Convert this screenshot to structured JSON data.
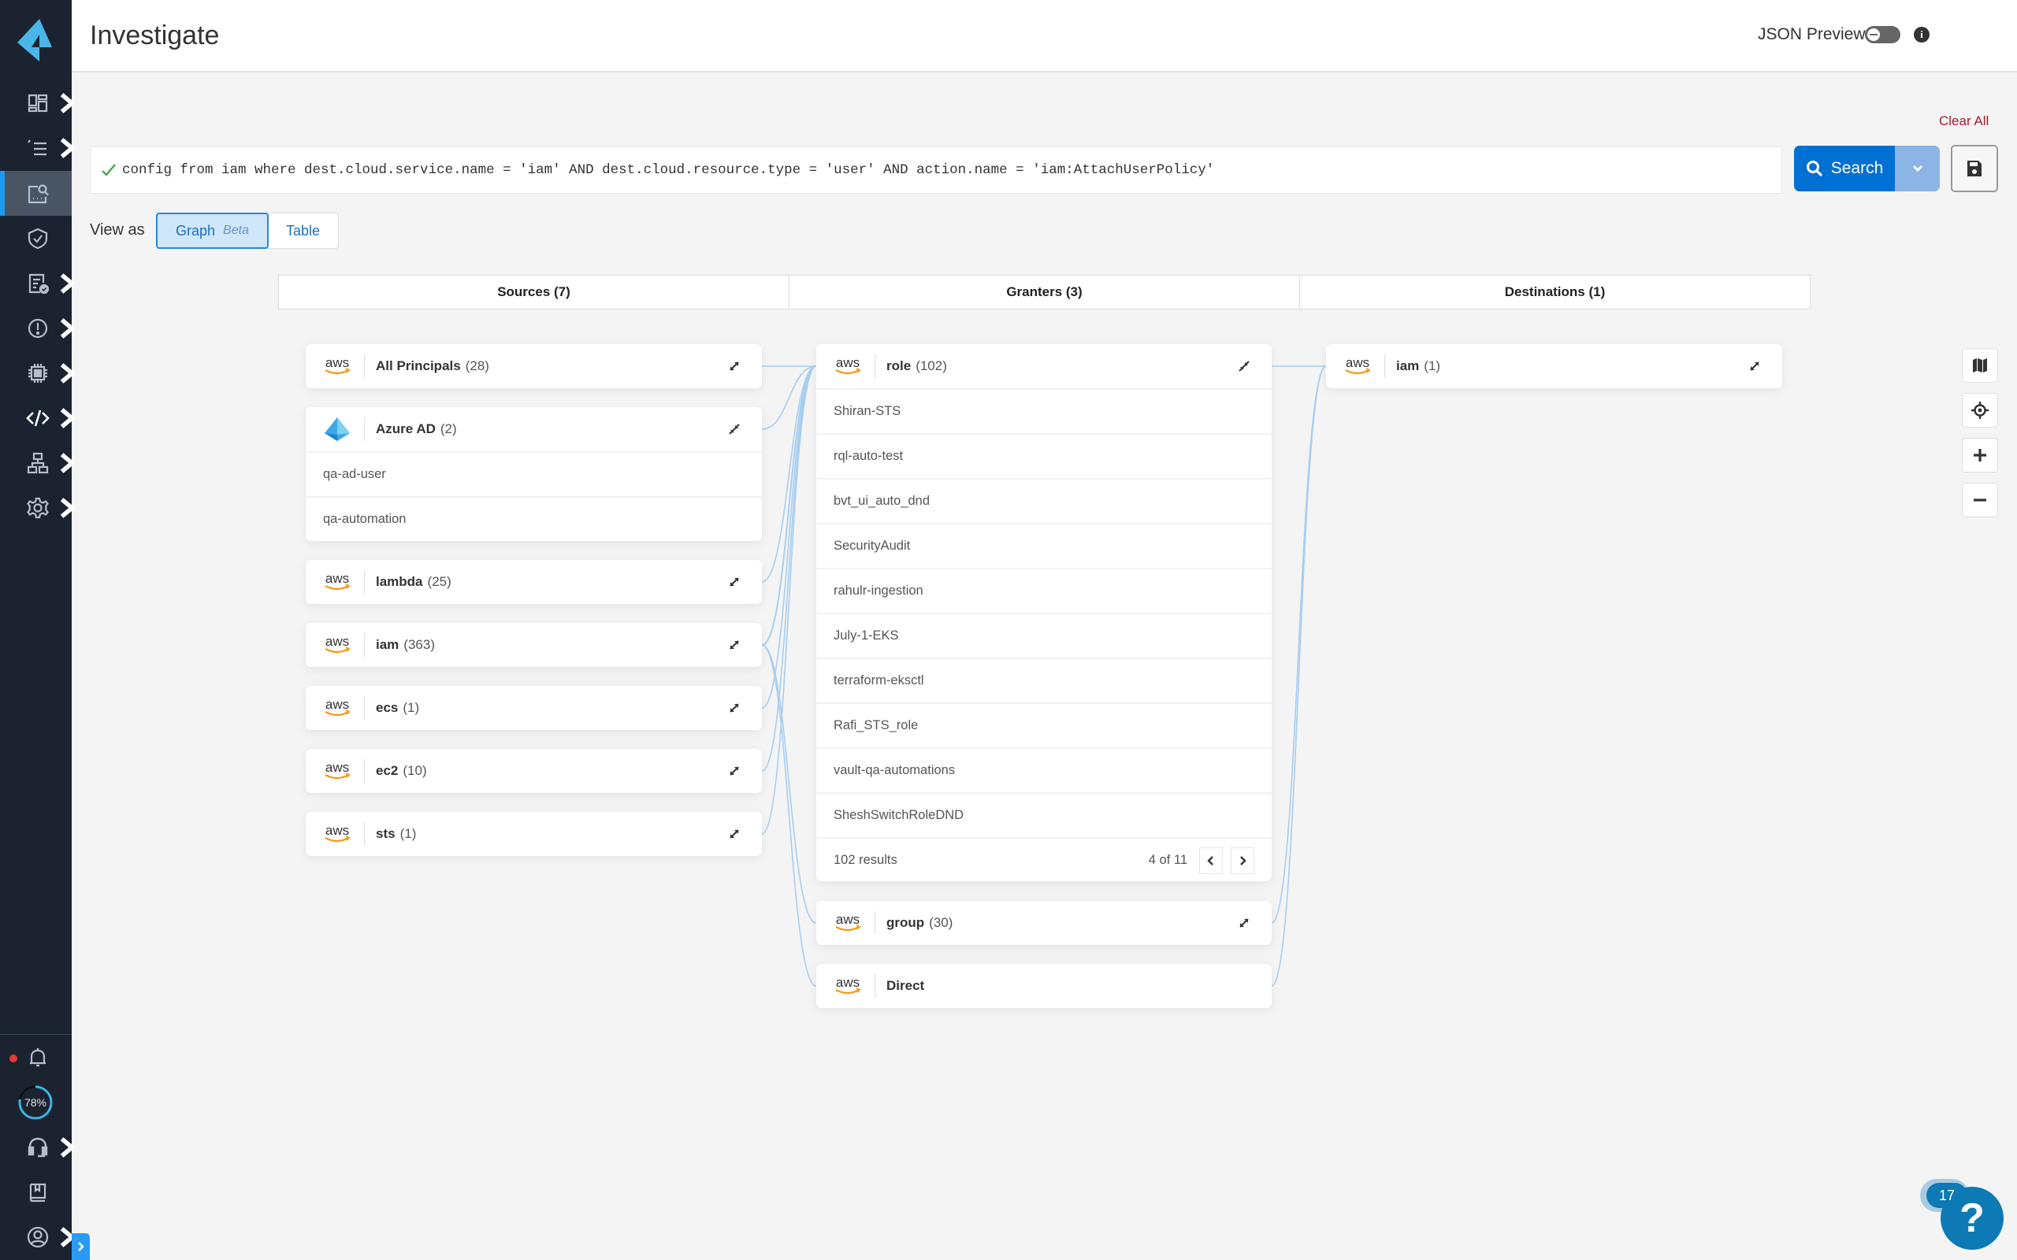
{
  "header": {
    "title": "Investigate",
    "json_preview_label": "JSON Preview",
    "json_preview_enabled": false
  },
  "sidebar": {
    "items": [
      {
        "icon": "dashboard-icon",
        "has_submenu": true
      },
      {
        "icon": "list-icon",
        "has_submenu": true
      },
      {
        "icon": "investigate-icon",
        "has_submenu": false,
        "active": true
      },
      {
        "icon": "shield-check-icon",
        "has_submenu": false
      },
      {
        "icon": "compliance-icon",
        "has_submenu": true
      },
      {
        "icon": "alert-icon",
        "has_submenu": true
      },
      {
        "icon": "chip-icon",
        "has_submenu": true
      },
      {
        "icon": "code-icon",
        "has_submenu": true
      },
      {
        "icon": "network-icon",
        "has_submenu": true
      },
      {
        "icon": "gear-icon",
        "has_submenu": true
      }
    ],
    "bottom": {
      "notifications_has_unread": true,
      "progress_text": "78%",
      "progress_value": 0.78
    }
  },
  "query": {
    "clear_all_label": "Clear All",
    "value": "config from iam where dest.cloud.service.name = 'iam' AND dest.cloud.resource.type = 'user' AND action.name = 'iam:AttachUserPolicy'",
    "valid": true,
    "search_label": "Search"
  },
  "view_as": {
    "label": "View as",
    "options": [
      {
        "label": "Graph",
        "badge": "Beta",
        "active": true
      },
      {
        "label": "Table",
        "active": false
      }
    ]
  },
  "columns": [
    {
      "label": "Sources (7)"
    },
    {
      "label": "Granters (3)"
    },
    {
      "label": "Destinations (1)"
    }
  ],
  "sources": [
    {
      "provider": "aws",
      "name": "All Principals",
      "count": "(28)",
      "expanded": false
    },
    {
      "provider": "azure",
      "name": "Azure AD",
      "count": "(2)",
      "expanded": true,
      "items": [
        "qa-ad-user",
        "qa-automation"
      ]
    },
    {
      "provider": "aws",
      "name": "lambda",
      "count": "(25)",
      "expanded": false
    },
    {
      "provider": "aws",
      "name": "iam",
      "count": "(363)",
      "expanded": false
    },
    {
      "provider": "aws",
      "name": "ecs",
      "count": "(1)",
      "expanded": false
    },
    {
      "provider": "aws",
      "name": "ec2",
      "count": "(10)",
      "expanded": false
    },
    {
      "provider": "aws",
      "name": "sts",
      "count": "(1)",
      "expanded": false
    }
  ],
  "granters": [
    {
      "provider": "aws",
      "name": "role",
      "count": "(102)",
      "expanded": true,
      "items": [
        "Shiran-STS",
        "rql-auto-test",
        "bvt_ui_auto_dnd",
        "SecurityAudit",
        "rahulr-ingestion",
        "July-1-EKS",
        "terraform-eksctl",
        "Rafi_STS_role",
        "vault-qa-automations",
        "SheshSwitchRoleDND"
      ],
      "results_label": "102 results",
      "page_label": "4 of 11"
    },
    {
      "provider": "aws",
      "name": "group",
      "count": "(30)",
      "expanded": false
    },
    {
      "provider": "aws",
      "name": "Direct",
      "count": "",
      "expanded": false
    }
  ],
  "destinations": [
    {
      "provider": "aws",
      "name": "iam",
      "count": "(1)",
      "expanded": false
    }
  ],
  "graph_tools": [
    "map-icon",
    "locate-icon",
    "zoom-in-icon",
    "zoom-out-icon"
  ],
  "help": {
    "badge_count": "17",
    "label": "?"
  },
  "colors": {
    "sidebar_bg": "#1c2330",
    "accent": "#0070d2",
    "edge": "#a8cdf0",
    "clear_all": "#a51d2d",
    "aws_orange": "#f29c1f"
  }
}
